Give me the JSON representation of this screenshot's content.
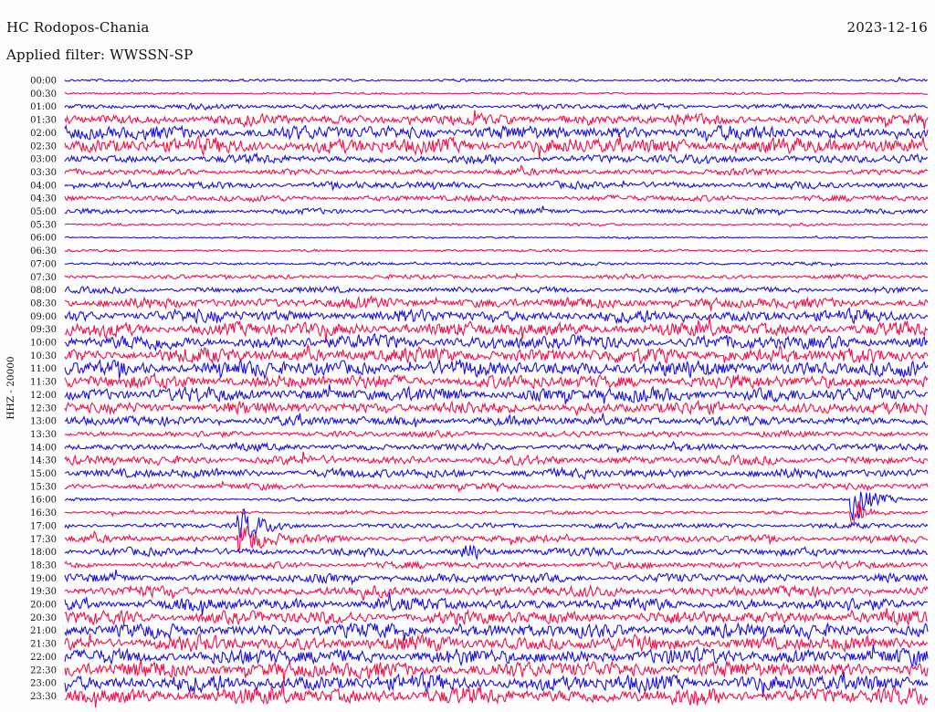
{
  "header": {
    "station": "HC Rodopos-Chania",
    "date": "2023-12-16",
    "filter": "Applied filter: WWSSN-SP"
  },
  "colors": {
    "trace_a": "#1a10dd",
    "trace_b": "#f2104a",
    "background": "#fdfdfd",
    "text": "#111111"
  },
  "chart_data": {
    "type": "line",
    "title": "HC Rodopos-Chania",
    "ylabel": "HHZ - 20000",
    "xlabel": "",
    "grid": false,
    "legend": "none",
    "row_labels": [
      "00:00",
      "00:30",
      "01:00",
      "01:30",
      "02:00",
      "02:30",
      "03:00",
      "03:30",
      "04:00",
      "04:30",
      "05:00",
      "05:30",
      "06:00",
      "06:30",
      "07:00",
      "07:30",
      "08:00",
      "08:30",
      "09:00",
      "09:30",
      "10:00",
      "10:30",
      "11:00",
      "11:30",
      "12:00",
      "12:30",
      "13:00",
      "13:30",
      "14:00",
      "14:30",
      "15:00",
      "15:30",
      "16:00",
      "16:30",
      "17:00",
      "17:30",
      "18:00",
      "18:30",
      "19:00",
      "19:30",
      "20:00",
      "20:30",
      "21:00",
      "21:30",
      "22:00",
      "22:30",
      "23:00",
      "23:30"
    ],
    "row_colors": [
      "blue",
      "red"
    ],
    "noise_level": [
      1.5,
      1.2,
      3,
      6,
      8,
      9,
      5,
      3.5,
      4,
      3.5,
      3,
      1.5,
      1,
      1.4,
      1.8,
      2.5,
      3.5,
      6,
      7,
      8,
      8,
      8.5,
      9,
      8,
      8,
      7,
      5.5,
      3.5,
      4,
      5,
      5.5,
      3.5,
      1.8,
      2,
      3,
      4,
      4.5,
      4,
      5,
      6,
      7,
      7.5,
      8,
      8.5,
      9,
      9.5,
      9.5,
      9.5
    ],
    "events": [
      {
        "row": 34,
        "center": 0.21,
        "amplitude": 4.5,
        "width": 0.06
      },
      {
        "row": 35,
        "center": 0.21,
        "amplitude": 5,
        "width": 0.06
      },
      {
        "row": 36,
        "center": 0.47,
        "amplitude": 2.5,
        "width": 0.03
      },
      {
        "row": 32,
        "center": 0.92,
        "amplitude": 6,
        "width": 0.05
      },
      {
        "row": 33,
        "center": 0.92,
        "amplitude": 4,
        "width": 0.04
      }
    ]
  }
}
